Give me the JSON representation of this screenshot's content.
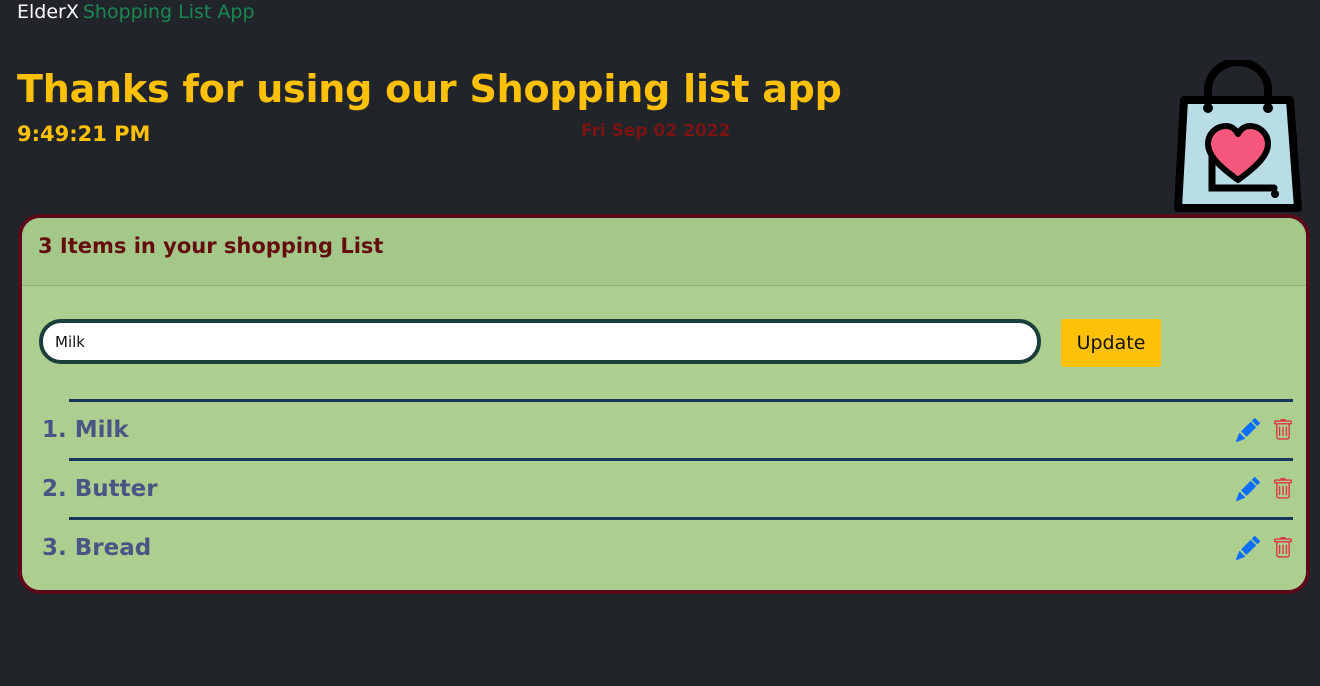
{
  "navbar": {
    "brand_primary": "ElderX",
    "brand_secondary": "Shopping List App"
  },
  "header": {
    "title": "Thanks for using our Shopping list app",
    "time": "9:49:21 PM",
    "date": "Fri Sep 02 2022",
    "logo_icon": "shopping-bag-heart-icon"
  },
  "card": {
    "title": "3 Items in your shopping List",
    "input_value": "Milk",
    "update_label": "Update",
    "items": [
      {
        "label": "1. Milk",
        "edit_icon": "pencil-icon",
        "delete_icon": "trash-icon"
      },
      {
        "label": "2. Butter",
        "edit_icon": "pencil-icon",
        "delete_icon": "trash-icon"
      },
      {
        "label": "3. Bread",
        "edit_icon": "pencil-icon",
        "delete_icon": "trash-icon"
      }
    ]
  },
  "colors": {
    "background": "#212529",
    "accent": "#ffc107",
    "card_bg": "#accf8f",
    "card_border": "#5b0a1c",
    "item_text": "#4a5585",
    "edit_icon": "#0d6efd",
    "delete_icon": "#dc3545"
  }
}
